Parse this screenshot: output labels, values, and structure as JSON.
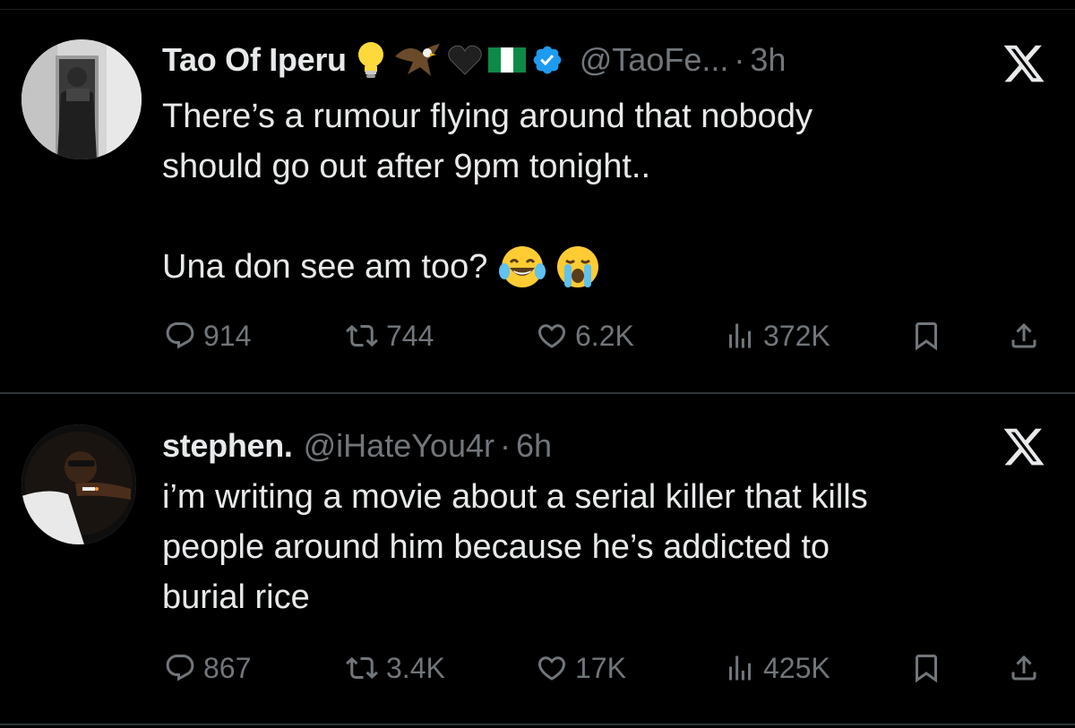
{
  "tweets": [
    {
      "name": "Tao Of Iperu",
      "handle": "@TaoFe...",
      "dot": "·",
      "time": "3h",
      "badges": [
        "lightbulb-emoji",
        "eagle-emoji",
        "black-heart-emoji",
        "nigeria-flag-emoji",
        "verified-badge"
      ],
      "lines": [
        "There’s a rumour flying around that nobody",
        "should go out after 9pm tonight..",
        "",
        "Una don see am too?"
      ],
      "trailing_emojis": [
        "laughing-tears-emoji",
        "loudly-crying-emoji"
      ],
      "stats": {
        "replies": "914",
        "reposts": "744",
        "likes": "6.2K",
        "views": "372K"
      }
    },
    {
      "name": "stephen.",
      "handle": "@iHateYou4r",
      "dot": "·",
      "time": "6h",
      "lines": [
        "i’m writing a movie about a serial killer that kills",
        "people around him because he’s addicted to",
        "burial rice"
      ],
      "stats": {
        "replies": "867",
        "reposts": "3.4K",
        "likes": "17K",
        "views": "425K"
      }
    }
  ],
  "colors": {
    "background": "#000000",
    "text": "#e7e9ea",
    "muted": "#71767b",
    "verified": "#1d9bf0",
    "divider": "#2f3336"
  },
  "icons": [
    "reply-icon",
    "repost-icon",
    "like-icon",
    "views-icon",
    "bookmark-icon",
    "share-icon",
    "x-logo-icon"
  ]
}
